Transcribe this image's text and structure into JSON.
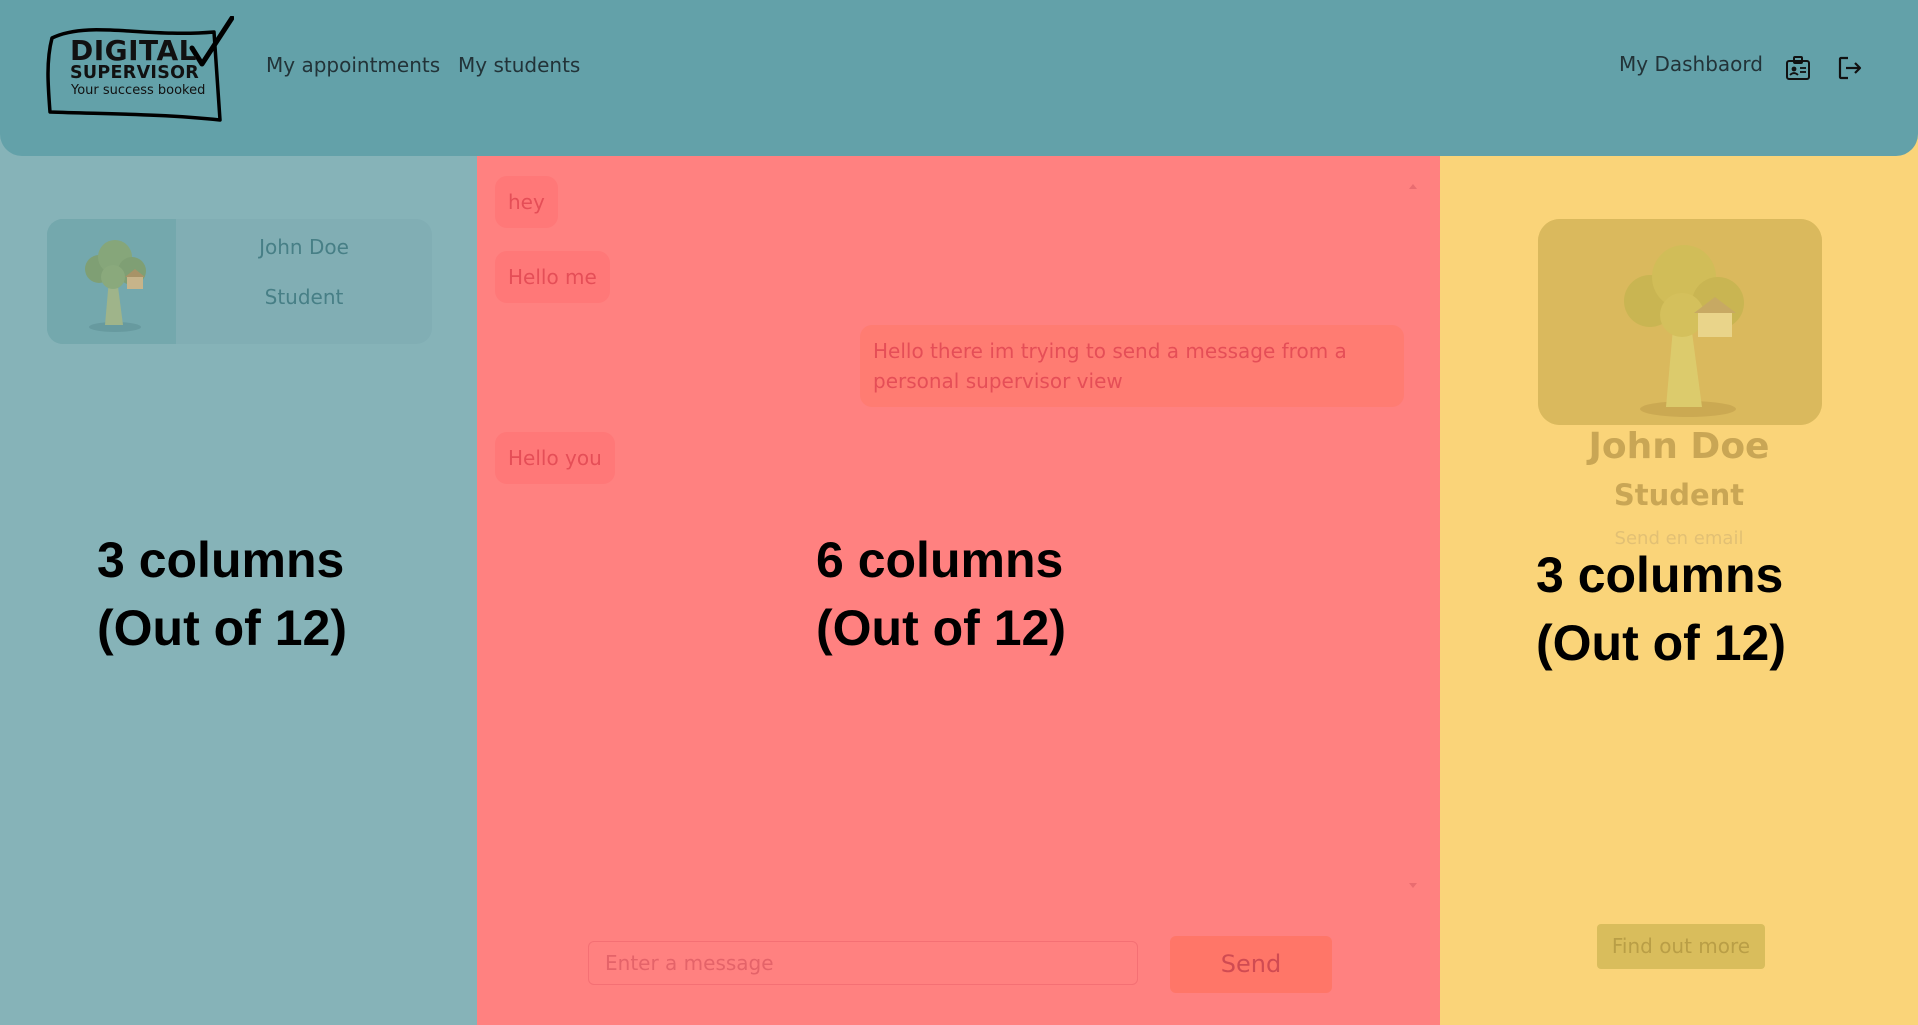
{
  "navbar": {
    "logo": {
      "line1": "DIGITAL",
      "line2": "SUPERVISOR",
      "tagline": "Your success booked"
    },
    "links": [
      "My appointments",
      "My students"
    ],
    "dashboard_label": "My Dashbaord",
    "icons": [
      "id-badge-icon",
      "logout-icon"
    ]
  },
  "left_column": {
    "label": "3 columns\n(Out of 12)",
    "user_card": {
      "name": "John Doe",
      "role": "Student",
      "photo": "broccoli-treehouse-photo"
    }
  },
  "chat": {
    "label": "6 columns\n(Out of 12)",
    "messages": [
      {
        "text": "hey",
        "direction": "incoming"
      },
      {
        "text": "Hello me",
        "direction": "incoming"
      },
      {
        "text": "Hello there im trying to send a message from a personal supervisor view",
        "direction": "outgoing"
      },
      {
        "text": "Hello you",
        "direction": "incoming"
      }
    ],
    "input_placeholder": "Enter a message",
    "send_label": "Send"
  },
  "right_column": {
    "label": "3 columns\n(Out of 12)",
    "profile": {
      "name": "John Doe",
      "role": "Student",
      "email_link": "Send en email",
      "photo": "broccoli-treehouse-photo"
    },
    "find_out_more_label": "Find out more"
  },
  "colors": {
    "navbar": "#63a1a9",
    "left_column": "#86b3b8",
    "middle_column": "#ff8180",
    "right_column": "#fad479"
  }
}
